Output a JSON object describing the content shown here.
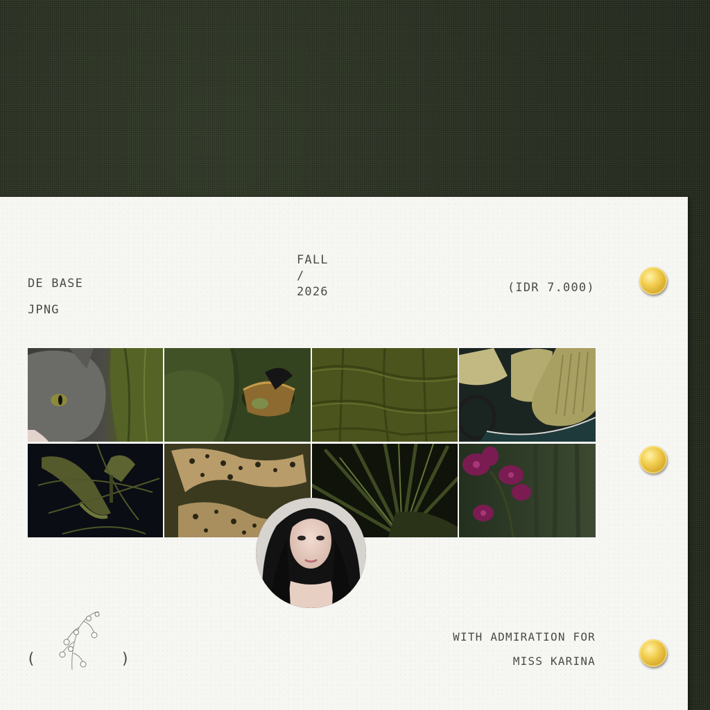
{
  "header": {
    "brand": "DE BASE",
    "subtitle": "JPNG",
    "season_line1": "FALL",
    "season_line2": "/",
    "season_line3": "2026",
    "price": "(IDR 7.000)"
  },
  "gallery": {
    "tiles": [
      "cat-with-olive-leather-photo",
      "basket-on-green-cushion-photo",
      "olive-croc-leather-photo",
      "vintage-car-olive-seats-photo",
      "olive-strappy-heels-photo",
      "leopard-print-velvet-photo",
      "palm-frond-photo",
      "purple-orchid-photo"
    ]
  },
  "footer": {
    "paren_open": "(",
    "paren_close": ")",
    "dedication_line1": "WITH ADMIRATION FOR",
    "dedication_line2": "MISS KARINA"
  },
  "colors": {
    "background_fabric": "#2b3224",
    "paper": "#f6f6f3",
    "text": "#4a4a48",
    "pin_gold": "#e8c24a"
  }
}
